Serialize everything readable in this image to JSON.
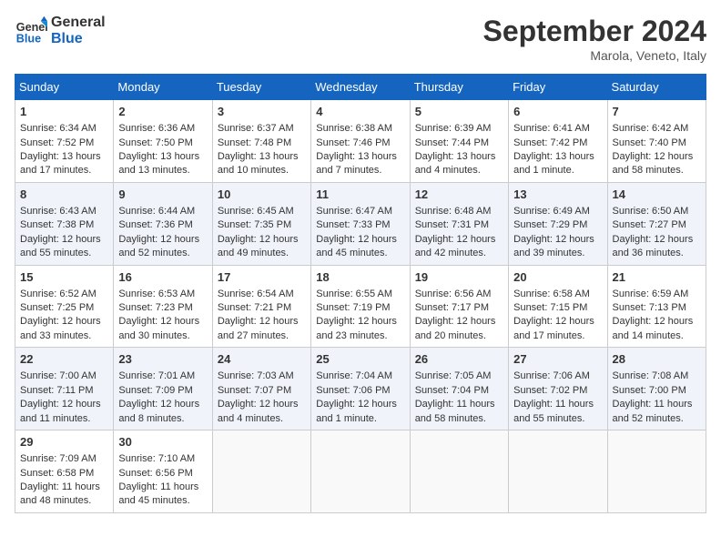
{
  "header": {
    "logo_line1": "General",
    "logo_line2": "Blue",
    "month": "September 2024",
    "location": "Marola, Veneto, Italy"
  },
  "weekdays": [
    "Sunday",
    "Monday",
    "Tuesday",
    "Wednesday",
    "Thursday",
    "Friday",
    "Saturday"
  ],
  "weeks": [
    [
      {
        "day": "1",
        "rise": "Sunrise: 6:34 AM",
        "set": "Sunset: 7:52 PM",
        "day_text": "Daylight: 13 hours and 17 minutes."
      },
      {
        "day": "2",
        "rise": "Sunrise: 6:36 AM",
        "set": "Sunset: 7:50 PM",
        "day_text": "Daylight: 13 hours and 13 minutes."
      },
      {
        "day": "3",
        "rise": "Sunrise: 6:37 AM",
        "set": "Sunset: 7:48 PM",
        "day_text": "Daylight: 13 hours and 10 minutes."
      },
      {
        "day": "4",
        "rise": "Sunrise: 6:38 AM",
        "set": "Sunset: 7:46 PM",
        "day_text": "Daylight: 13 hours and 7 minutes."
      },
      {
        "day": "5",
        "rise": "Sunrise: 6:39 AM",
        "set": "Sunset: 7:44 PM",
        "day_text": "Daylight: 13 hours and 4 minutes."
      },
      {
        "day": "6",
        "rise": "Sunrise: 6:41 AM",
        "set": "Sunset: 7:42 PM",
        "day_text": "Daylight: 13 hours and 1 minute."
      },
      {
        "day": "7",
        "rise": "Sunrise: 6:42 AM",
        "set": "Sunset: 7:40 PM",
        "day_text": "Daylight: 12 hours and 58 minutes."
      }
    ],
    [
      {
        "day": "8",
        "rise": "Sunrise: 6:43 AM",
        "set": "Sunset: 7:38 PM",
        "day_text": "Daylight: 12 hours and 55 minutes."
      },
      {
        "day": "9",
        "rise": "Sunrise: 6:44 AM",
        "set": "Sunset: 7:36 PM",
        "day_text": "Daylight: 12 hours and 52 minutes."
      },
      {
        "day": "10",
        "rise": "Sunrise: 6:45 AM",
        "set": "Sunset: 7:35 PM",
        "day_text": "Daylight: 12 hours and 49 minutes."
      },
      {
        "day": "11",
        "rise": "Sunrise: 6:47 AM",
        "set": "Sunset: 7:33 PM",
        "day_text": "Daylight: 12 hours and 45 minutes."
      },
      {
        "day": "12",
        "rise": "Sunrise: 6:48 AM",
        "set": "Sunset: 7:31 PM",
        "day_text": "Daylight: 12 hours and 42 minutes."
      },
      {
        "day": "13",
        "rise": "Sunrise: 6:49 AM",
        "set": "Sunset: 7:29 PM",
        "day_text": "Daylight: 12 hours and 39 minutes."
      },
      {
        "day": "14",
        "rise": "Sunrise: 6:50 AM",
        "set": "Sunset: 7:27 PM",
        "day_text": "Daylight: 12 hours and 36 minutes."
      }
    ],
    [
      {
        "day": "15",
        "rise": "Sunrise: 6:52 AM",
        "set": "Sunset: 7:25 PM",
        "day_text": "Daylight: 12 hours and 33 minutes."
      },
      {
        "day": "16",
        "rise": "Sunrise: 6:53 AM",
        "set": "Sunset: 7:23 PM",
        "day_text": "Daylight: 12 hours and 30 minutes."
      },
      {
        "day": "17",
        "rise": "Sunrise: 6:54 AM",
        "set": "Sunset: 7:21 PM",
        "day_text": "Daylight: 12 hours and 27 minutes."
      },
      {
        "day": "18",
        "rise": "Sunrise: 6:55 AM",
        "set": "Sunset: 7:19 PM",
        "day_text": "Daylight: 12 hours and 23 minutes."
      },
      {
        "day": "19",
        "rise": "Sunrise: 6:56 AM",
        "set": "Sunset: 7:17 PM",
        "day_text": "Daylight: 12 hours and 20 minutes."
      },
      {
        "day": "20",
        "rise": "Sunrise: 6:58 AM",
        "set": "Sunset: 7:15 PM",
        "day_text": "Daylight: 12 hours and 17 minutes."
      },
      {
        "day": "21",
        "rise": "Sunrise: 6:59 AM",
        "set": "Sunset: 7:13 PM",
        "day_text": "Daylight: 12 hours and 14 minutes."
      }
    ],
    [
      {
        "day": "22",
        "rise": "Sunrise: 7:00 AM",
        "set": "Sunset: 7:11 PM",
        "day_text": "Daylight: 12 hours and 11 minutes."
      },
      {
        "day": "23",
        "rise": "Sunrise: 7:01 AM",
        "set": "Sunset: 7:09 PM",
        "day_text": "Daylight: 12 hours and 8 minutes."
      },
      {
        "day": "24",
        "rise": "Sunrise: 7:03 AM",
        "set": "Sunset: 7:07 PM",
        "day_text": "Daylight: 12 hours and 4 minutes."
      },
      {
        "day": "25",
        "rise": "Sunrise: 7:04 AM",
        "set": "Sunset: 7:06 PM",
        "day_text": "Daylight: 12 hours and 1 minute."
      },
      {
        "day": "26",
        "rise": "Sunrise: 7:05 AM",
        "set": "Sunset: 7:04 PM",
        "day_text": "Daylight: 11 hours and 58 minutes."
      },
      {
        "day": "27",
        "rise": "Sunrise: 7:06 AM",
        "set": "Sunset: 7:02 PM",
        "day_text": "Daylight: 11 hours and 55 minutes."
      },
      {
        "day": "28",
        "rise": "Sunrise: 7:08 AM",
        "set": "Sunset: 7:00 PM",
        "day_text": "Daylight: 11 hours and 52 minutes."
      }
    ],
    [
      {
        "day": "29",
        "rise": "Sunrise: 7:09 AM",
        "set": "Sunset: 6:58 PM",
        "day_text": "Daylight: 11 hours and 48 minutes."
      },
      {
        "day": "30",
        "rise": "Sunrise: 7:10 AM",
        "set": "Sunset: 6:56 PM",
        "day_text": "Daylight: 11 hours and 45 minutes."
      },
      null,
      null,
      null,
      null,
      null
    ]
  ]
}
